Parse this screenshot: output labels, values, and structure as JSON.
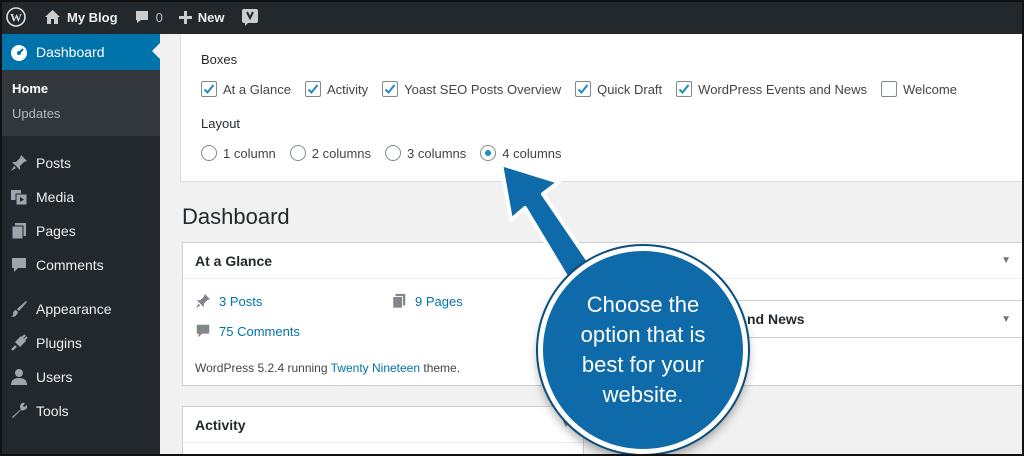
{
  "adminbar": {
    "site_name": "My Blog",
    "comment_count": "0",
    "new_label": "New",
    "icons": [
      "wordpress-logo-icon",
      "home-icon",
      "comment-bubble-icon",
      "plus-icon",
      "yoast-icon"
    ]
  },
  "sidebar": {
    "dashboard_label": "Dashboard",
    "sub_home": "Home",
    "sub_updates": "Updates",
    "items": [
      {
        "label": "Posts",
        "icon": "pushpin-icon"
      },
      {
        "label": "Media",
        "icon": "media-icon"
      },
      {
        "label": "Pages",
        "icon": "pages-icon"
      },
      {
        "label": "Comments",
        "icon": "comments-icon"
      },
      {
        "label": "Appearance",
        "icon": "brush-icon"
      },
      {
        "label": "Plugins",
        "icon": "plug-icon"
      },
      {
        "label": "Users",
        "icon": "user-icon"
      },
      {
        "label": "Tools",
        "icon": "wrench-icon"
      }
    ]
  },
  "screen_options": {
    "boxes_heading": "Boxes",
    "boxes": [
      {
        "label": "At a Glance",
        "checked": true
      },
      {
        "label": "Activity",
        "checked": true
      },
      {
        "label": "Yoast SEO Posts Overview",
        "checked": true
      },
      {
        "label": "Quick Draft",
        "checked": true
      },
      {
        "label": "WordPress Events and News",
        "checked": true
      },
      {
        "label": "Welcome",
        "checked": false
      }
    ],
    "layout_heading": "Layout",
    "layouts": [
      {
        "label": "1 column",
        "checked": false
      },
      {
        "label": "2 columns",
        "checked": false
      },
      {
        "label": "3 columns",
        "checked": false
      },
      {
        "label": "4 columns",
        "checked": true
      }
    ]
  },
  "page_title": "Dashboard",
  "glance": {
    "title": "At a Glance",
    "posts": "3 Posts",
    "pages": "9 Pages",
    "comments": "75 Comments",
    "version_prefix": "WordPress 5.2.4 running ",
    "theme": "Twenty Nineteen",
    "version_suffix": " theme."
  },
  "events_partial_title": "nd News",
  "activity_title": "Activity",
  "callout_text": "Choose the option that is best for your website.",
  "colors": {
    "admin_bg": "#23282d",
    "accent": "#0073aa",
    "callout": "#0e6aa8"
  }
}
